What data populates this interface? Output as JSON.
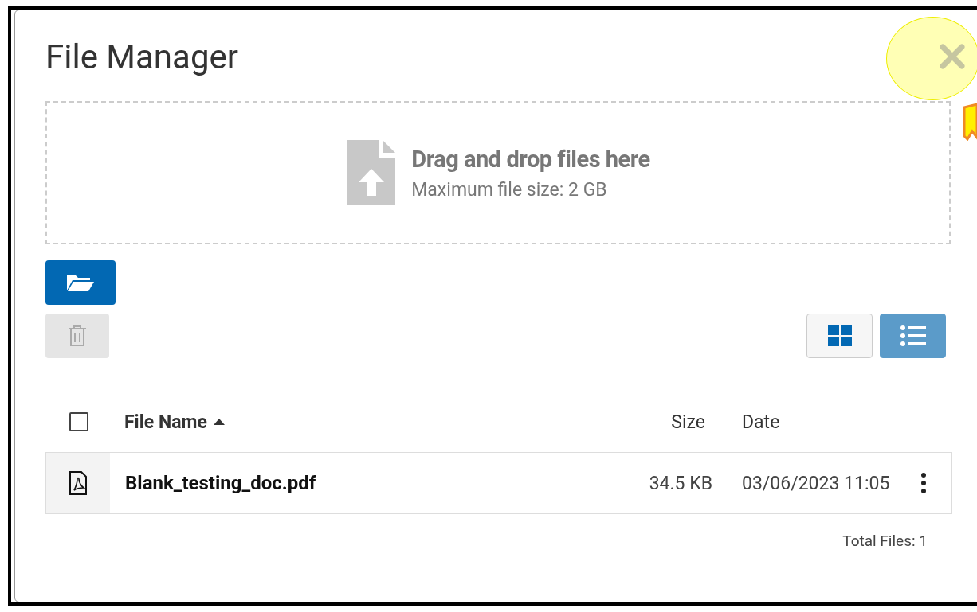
{
  "dialog": {
    "title": "File Manager",
    "close_highlighted": true
  },
  "drop_zone": {
    "heading": "Drag and drop files here",
    "hint": "Maximum file size: 2 GB"
  },
  "toolbar": {
    "delete_disabled": true
  },
  "view_toggle": [
    {
      "kind": "grid",
      "selected": false
    },
    {
      "kind": "list",
      "selected": true
    }
  ],
  "table": {
    "select_all_checked": false,
    "columns": [
      {
        "label": "File Name",
        "sorted_ascending": true
      },
      {
        "label": "Size"
      },
      {
        "label": "Date"
      }
    ],
    "rows": [
      {
        "kind": "pdf",
        "name": "Blank_testing_doc.pdf",
        "size": "34.5 KB",
        "date": "03/06/2023 11:05"
      }
    ]
  },
  "footer": {
    "total": "Total Files: 1"
  }
}
